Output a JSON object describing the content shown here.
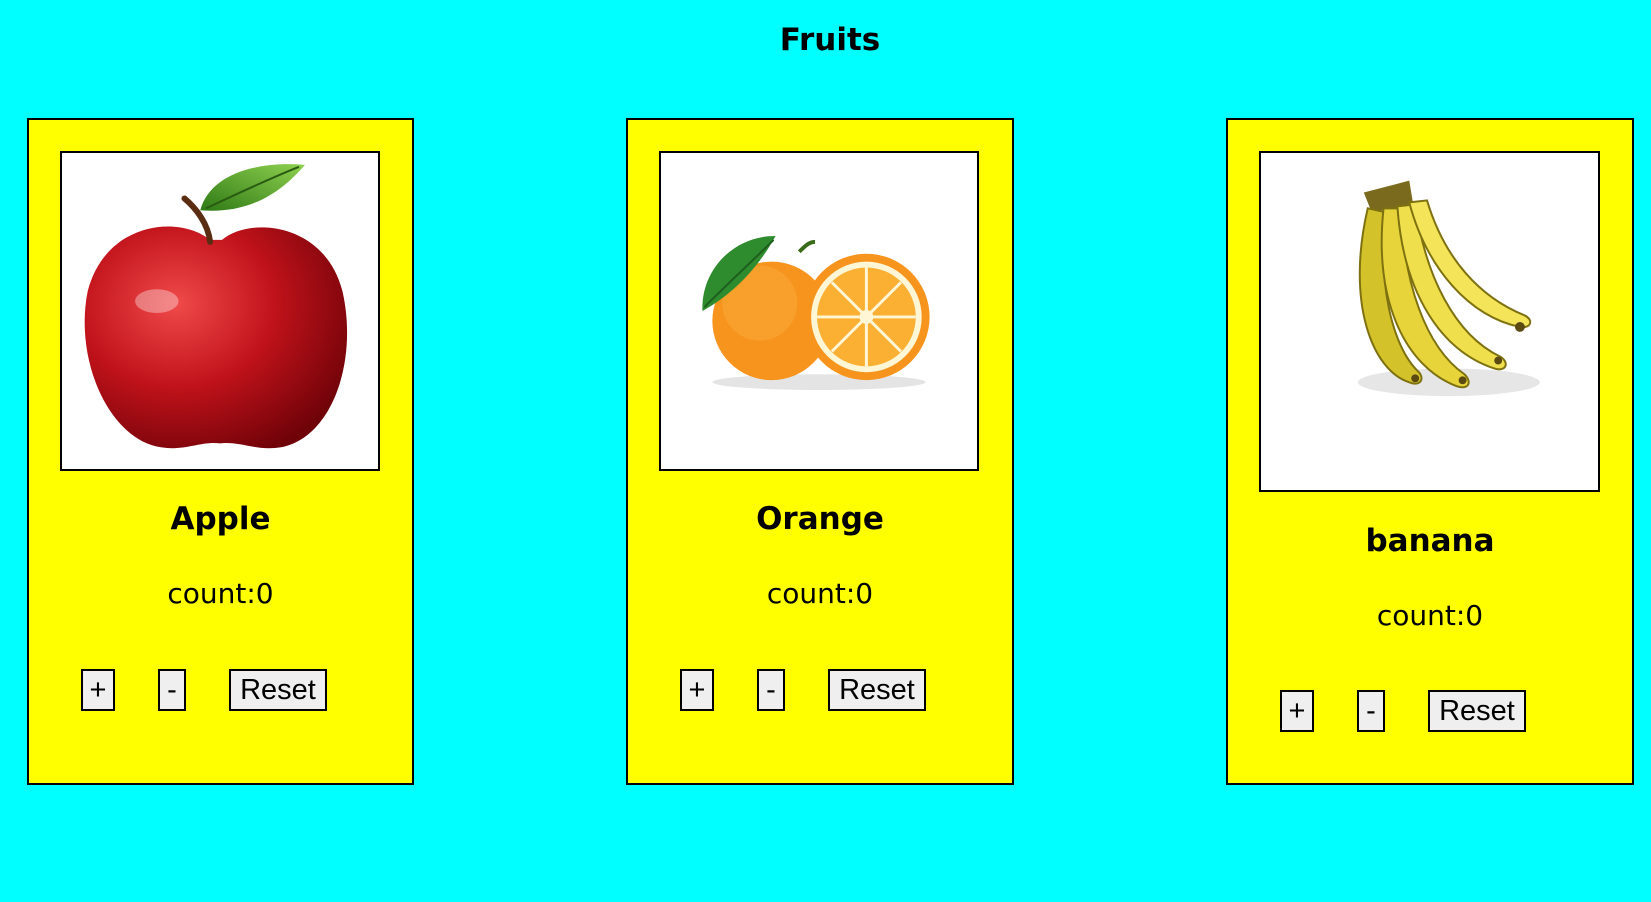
{
  "page": {
    "title": "Fruits",
    "background": "#00ffff",
    "card_background": "#ffff00"
  },
  "cards": [
    {
      "name": "Apple",
      "count_text": "count:0",
      "image": "apple-image",
      "buttons": {
        "increment": "+",
        "decrement": "-",
        "reset": "Reset"
      }
    },
    {
      "name": "Orange",
      "count_text": "count:0",
      "image": "orange-image",
      "buttons": {
        "increment": "+",
        "decrement": "-",
        "reset": "Reset"
      }
    },
    {
      "name": "banana",
      "count_text": "count:0",
      "image": "banana-image",
      "buttons": {
        "increment": "+",
        "decrement": "-",
        "reset": "Reset"
      }
    }
  ]
}
